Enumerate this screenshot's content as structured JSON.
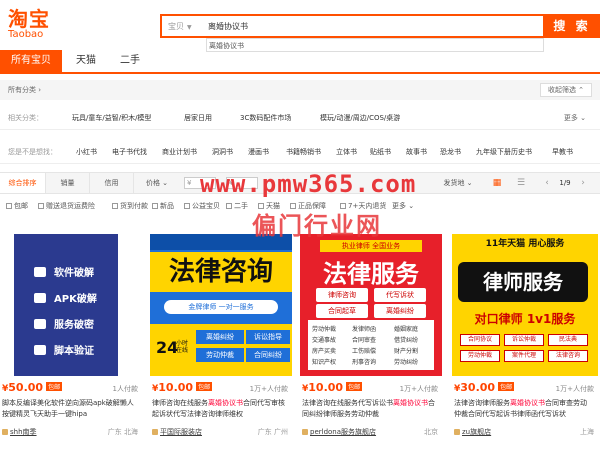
{
  "header": {
    "logo_cn": "淘宝",
    "logo_en": "Taobao"
  },
  "search": {
    "scope": "宝贝",
    "value": "离婚协议书",
    "button": "搜 索",
    "suggestion": "离婚协议书"
  },
  "tabs": [
    "所有宝贝",
    "天猫",
    "二手"
  ],
  "crumb": {
    "text": "所有分类 ›",
    "collapse": "收起筛选 ⌃"
  },
  "related": {
    "label": "相关分类：",
    "items": [
      "玩具/童车/益智/积木/模型",
      "居家日用",
      "3C数码配件市场",
      "模玩/动漫/周边/COS/桌游"
    ],
    "more": "更多 ⌄"
  },
  "guess": {
    "label": "您是不是想找：",
    "items": [
      "小红书",
      "电子书代找",
      "商业计划书",
      "洞洞书",
      "漫画书",
      "书籍畅销书",
      "立体书",
      "贴纸书",
      "故事书",
      "恐龙书",
      "九年级下册历史书",
      "早教书"
    ]
  },
  "sort": {
    "items": [
      "综合排序",
      "销量",
      "信用",
      "价格 ⌄"
    ],
    "price_from": "¥",
    "price_to": "¥",
    "ship": "发货地 ⌄",
    "page": "1/9",
    "prev": "‹",
    "next": "›",
    "grid_icon": "▦",
    "list_icon": "☰"
  },
  "filters": [
    "包邮",
    "赠送退货运费险",
    "货到付款",
    "新品",
    "公益宝贝",
    "二手",
    "天猫",
    "正品保障",
    "7+天内退货"
  ],
  "filters_more": "更多 ⌄",
  "watermark": {
    "line1": "www.pmw365.com",
    "line2": "偏门行业网"
  },
  "products": [
    {
      "price": "50.00",
      "tag": "包邮",
      "pay": "1人付款",
      "title_pre": "脚本反编译美化软件逆向源码apk破解懒人按键精灵飞天助手一键hipa",
      "title_em": "",
      "title_post": "",
      "shop": "shh南季",
      "loc": "广东 北海",
      "lines": [
        "软件破解",
        "APK破解",
        "服务破密",
        "脚本验证"
      ]
    },
    {
      "price": "10.00",
      "tag": "包邮",
      "pay": "1万+人付款",
      "title_pre": "律师咨询在线服务",
      "title_em": "离婚协议书",
      "title_post": "合同代写审核起诉状代写法律咨询律师维权",
      "shop": "平国际服装店",
      "loc": "广东 广州",
      "big": "法律咨询",
      "sub": "金牌律师 一对一服务",
      "num": "24",
      "nt": "小时 在线",
      "boxes": [
        "离婚纠纷",
        "诉讼指导",
        "劳动仲裁",
        "合同纠纷"
      ]
    },
    {
      "price": "10.00",
      "tag": "包邮",
      "pay": "1万+人付款",
      "title_pre": "法律咨询在线服务代写诉讼书",
      "title_em": "离婚协议书",
      "title_post": "合同纠纷律师服务劳动仲裁",
      "shop": "perldona服务旗舰店",
      "loc": "北京",
      "top": "执业律师 全国业务",
      "big": "法律服务",
      "boxes": [
        "律师咨询",
        "代写诉状",
        "合同起草",
        "离婚纠纷"
      ],
      "grid": [
        "劳动仲裁",
        "发律师函",
        "婚姻家庭",
        "交通事故",
        "合同审查",
        "借贷纠纷",
        "房产买卖",
        "工伤赔偿",
        "财产分割",
        "知识产权",
        "刑事咨询",
        "劳动纠纷"
      ]
    },
    {
      "price": "30.00",
      "tag": "包邮",
      "pay": "1万+人付款",
      "title_pre": "法律咨询律师服务",
      "title_em": "离婚协议书",
      "title_post": "合同审查劳动仲裁合同代写起诉书律师函代写诉状",
      "shop": "zu旗舰店",
      "loc": "上海",
      "top": "11年天猫 用心服务",
      "big": "律师服务",
      "mid": "对口律师  1v1服务",
      "boxes": [
        "合同协议",
        "诉讼仲裁",
        "民法典",
        "劳动仲裁",
        "案件代理",
        "法律咨询"
      ]
    }
  ],
  "colors": {
    "accent": "#ff5000",
    "price": "#ff4400"
  }
}
